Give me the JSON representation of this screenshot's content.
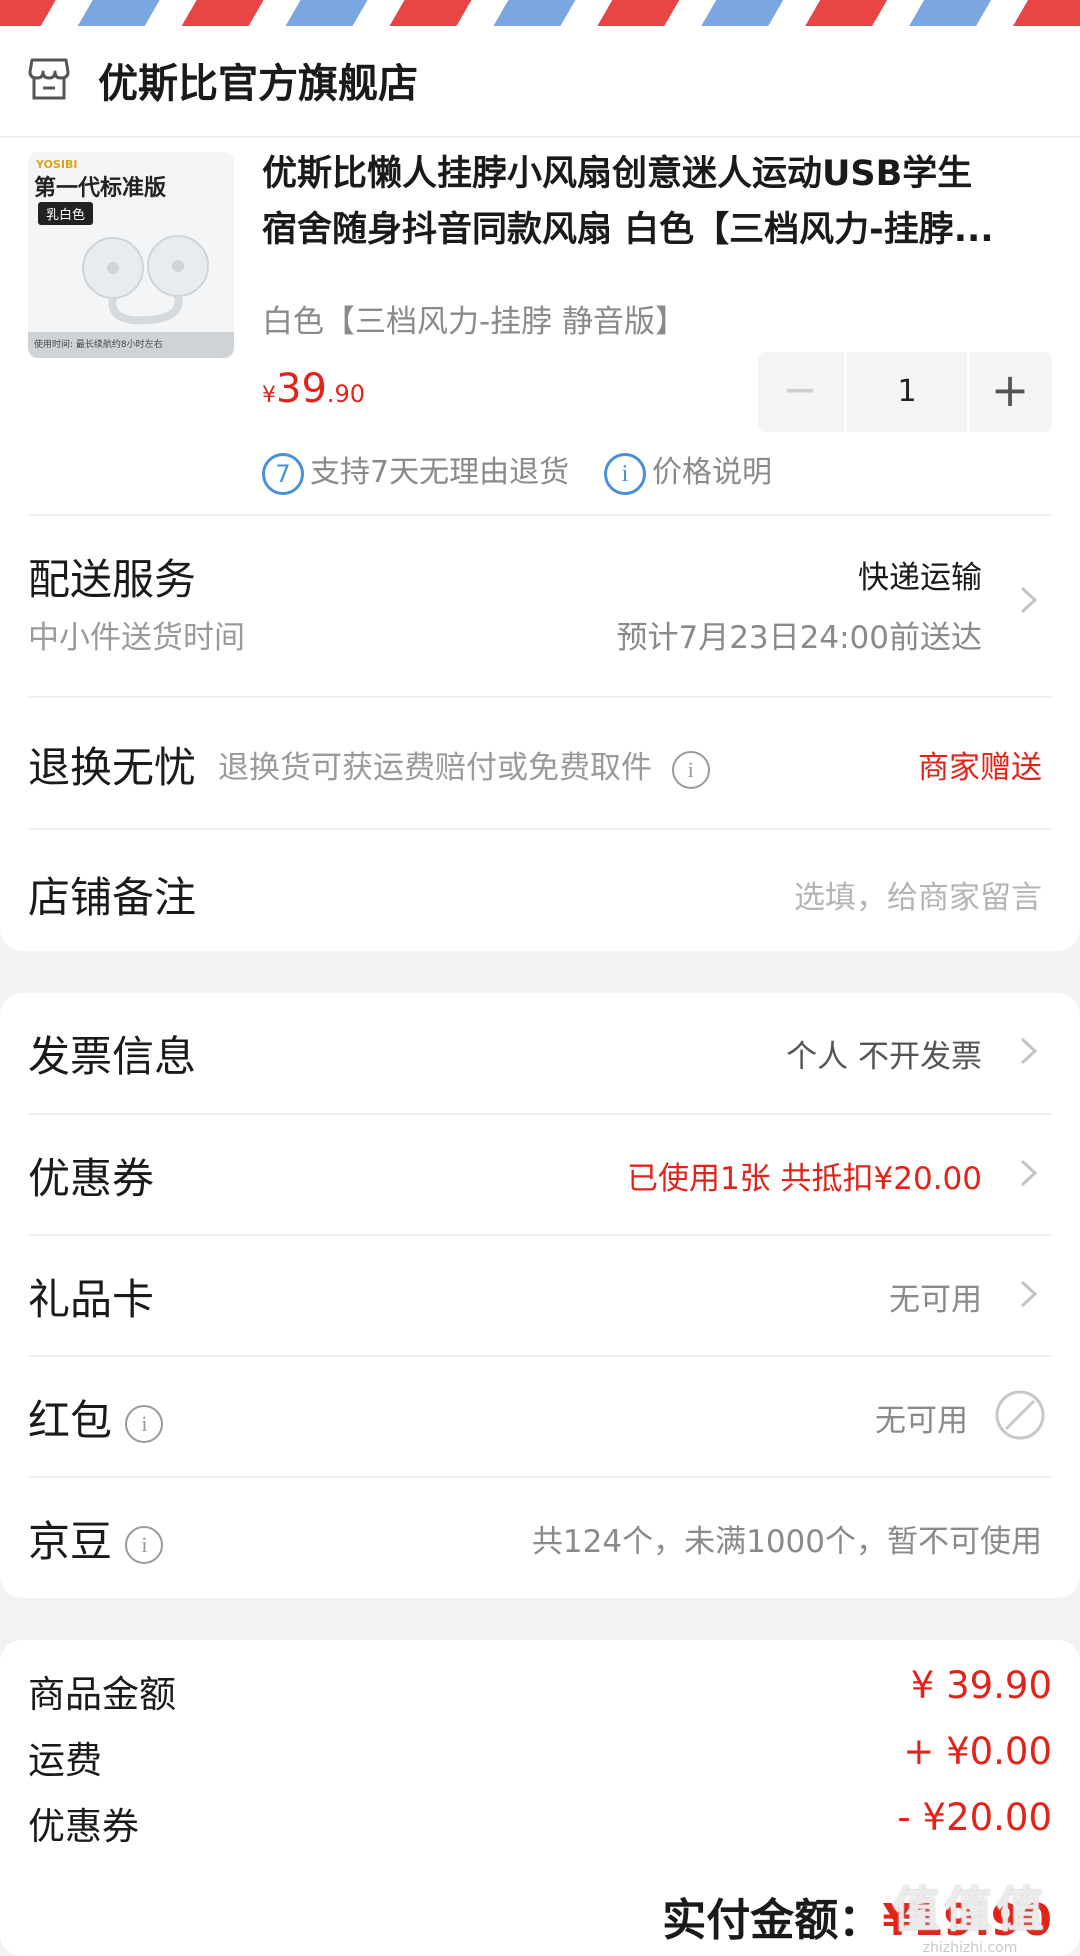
{
  "store": {
    "name": "优斯比官方旗舰店"
  },
  "product": {
    "title_line1": "优斯比懒人挂脖小风扇创意迷人运动USB学生",
    "title_line2": "宿舍随身抖音同款风扇 白色【三档风力-挂脖...",
    "spec": "白色【三档风力-挂脖 静音版】",
    "price_symbol": "¥",
    "price_int": "39",
    "price_dec": ".90",
    "quantity": "1",
    "thumb_badge": "第一代标准版",
    "thumb_tag": "乳白色",
    "thumb_brand": "YOSIBI",
    "thumb_foot": "使用时间: 最长续航约8小时左右",
    "return_badge": "7",
    "return_policy": "支持7天无理由退货",
    "price_info": "价格说明"
  },
  "delivery": {
    "label": "配送服务",
    "sub": "中小件送货时间",
    "method": "快递运输",
    "eta": "预计7月23日24:00前送达"
  },
  "return_worry": {
    "label": "退换无忧",
    "desc": "退换货可获运费赔付或免费取件",
    "value": "商家赠送"
  },
  "remark": {
    "label": "店铺备注",
    "placeholder": "选填，给商家留言"
  },
  "invoice": {
    "label": "发票信息",
    "value": "个人 不开发票"
  },
  "coupon": {
    "label": "优惠券",
    "value": "已使用1张 共抵扣¥20.00"
  },
  "giftcard": {
    "label": "礼品卡",
    "value": "无可用"
  },
  "redpacket": {
    "label": "红包",
    "value": "无可用"
  },
  "jingdou": {
    "label": "京豆",
    "value": "共124个，未满1000个，暂不可使用"
  },
  "summary": {
    "items": [
      {
        "label": "商品金额",
        "value": "¥ 39.90"
      },
      {
        "label": "运费",
        "value": "+ ¥0.00"
      },
      {
        "label": "优惠券",
        "value": "- ¥20.00"
      }
    ],
    "total_label": "实付金额：",
    "total_value": "¥19.90"
  },
  "watermark": {
    "text": "值值值",
    "url": "zhizhizhi.com"
  },
  "colors": {
    "accent": "#e2231a",
    "link": "#4a90d9",
    "background": "#f2f2f2"
  }
}
